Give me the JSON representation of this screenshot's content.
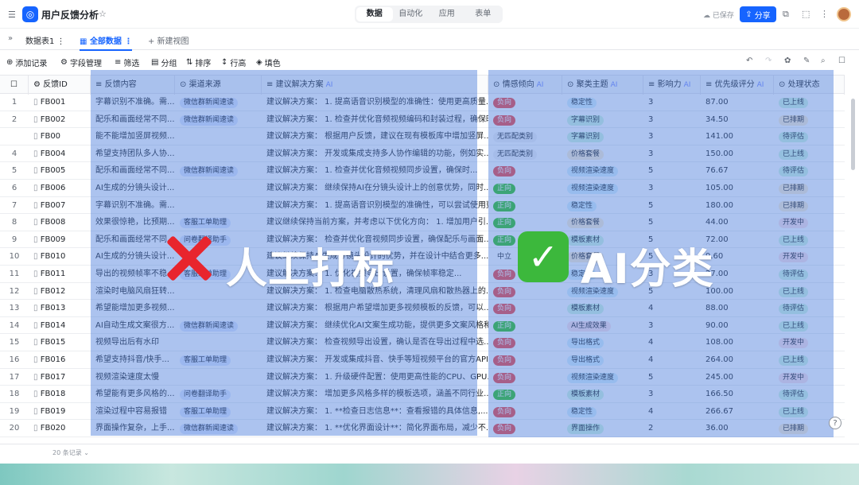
{
  "app": {
    "title": "用户反馈分析",
    "saved": "已保存",
    "share": "分享"
  },
  "nav_tabs": [
    "数据",
    "自动化",
    "应用",
    "表单"
  ],
  "sheet": {
    "name": "数据表1",
    "view": "全部数据",
    "new_view": "+ 新建视图"
  },
  "toolbar": {
    "add": "添加记录",
    "fields": "字段管理",
    "filter": "筛选",
    "group": "分组",
    "sort": "排序",
    "row_height": "行高",
    "fill": "填色"
  },
  "columns": {
    "id": "反馈ID",
    "content": "反馈内容",
    "source": "渠道来源",
    "solution": "建议解决方案",
    "sentiment": "情感倾向",
    "theme": "聚类主题",
    "impact": "影响力",
    "score": "优先级评分",
    "status": "处理状态",
    "ai": "AI"
  },
  "rows": [
    {
      "n": "1",
      "id": "FB001",
      "content": "字幕识别不准确。需...",
      "source": "微信群新闻速读",
      "solution": "建议解决方案： 1. 提高语音识别模型的准确性：使用更高质量...",
      "sent": "负向",
      "theme": "稳定性",
      "impact": "3",
      "score": "87.00",
      "status": "已上线"
    },
    {
      "n": "2",
      "id": "FB002",
      "content": "配乐和画面经常不同...",
      "source": "微信群新闻速读",
      "solution": "建议解决方案： 1. 检查并优化音频视频编码和封装过程，确保时...",
      "sent": "负向",
      "theme": "字幕识别",
      "impact": "3",
      "score": "34.50",
      "status": "已排期"
    },
    {
      "n": "",
      "id": "FB00",
      "content": "能不能增加竖屏视频...",
      "source": "",
      "solution": "建议解决方案： 根据用户反馈，建议在现有模板库中增加竖屏...",
      "sent": "无匹配类别",
      "theme": "字幕识别",
      "impact": "3",
      "score": "141.00",
      "status": "待评估"
    },
    {
      "n": "4",
      "id": "FB004",
      "content": "希望支持团队多人协...",
      "source": "",
      "solution": "建议解决方案： 开发或集成支持多人协作编辑的功能，例如实...",
      "sent": "无匹配类别",
      "theme": "价格套餐",
      "impact": "3",
      "score": "150.00",
      "status": "已上线"
    },
    {
      "n": "5",
      "id": "FB005",
      "content": "配乐和画面经常不同...",
      "source": "微信群新闻速读",
      "solution": "建议解决方案： 1. 检查并优化音频视频同步设置，确保时...",
      "sent": "负向",
      "theme": "视频渲染速度",
      "impact": "5",
      "score": "76.67",
      "status": "待评估"
    },
    {
      "n": "6",
      "id": "FB006",
      "content": "AI生成的分镜头设计...",
      "source": "",
      "solution": "建议解决方案： 继续保持AI在分镜头设计上的创意优势，同时...",
      "sent": "正向",
      "theme": "视频渲染速度",
      "impact": "3",
      "score": "105.00",
      "status": "已排期"
    },
    {
      "n": "7",
      "id": "FB007",
      "content": "字幕识别不准确。需...",
      "source": "",
      "solution": "建议解决方案： 1. 提高语音识别模型的准确性，可以尝试使用更高精度的模型...",
      "sent": "正向",
      "theme": "稳定性",
      "impact": "5",
      "score": "180.00",
      "status": "已排期"
    },
    {
      "n": "8",
      "id": "FB008",
      "content": "效果很惊艳，比预期...",
      "source": "客服工单助理",
      "solution": "建议继续保持当前方案，并考虑以下优化方向： 1. 增加用户引...",
      "sent": "正向",
      "theme": "价格套餐",
      "impact": "5",
      "score": "44.00",
      "status": "开发中"
    },
    {
      "n": "9",
      "id": "FB009",
      "content": "配乐和画面经常不同...",
      "source": "问卷翻译助手",
      "solution": "建议解决方案： 检查并优化音视频同步设置，确保配乐与画面...",
      "sent": "正向",
      "theme": "模板素材",
      "impact": "5",
      "score": "72.00",
      "status": "已上线"
    },
    {
      "n": "10",
      "id": "FB010",
      "content": "AI生成的分镜头设计...",
      "source": "",
      "solution": "建议继续保持AI生成分镜头设计的优势，并在设计中结合更多...",
      "sent": "中立",
      "theme": "价格套餐",
      "impact": "5",
      "score": "9.60",
      "status": "开发中"
    },
    {
      "n": "11",
      "id": "FB011",
      "content": "导出的视频帧率不稳...",
      "source": "客服工单助理",
      "solution": "建议解决方案： 1. 优化视频导出设置，确保帧率稳定...",
      "sent": "负向",
      "theme": "稳定性",
      "impact": "3",
      "score": "27.00",
      "status": "待评估"
    },
    {
      "n": "12",
      "id": "FB012",
      "content": "渲染时电脑风扇狂转...",
      "source": "",
      "solution": "建议解决方案： 1. 检查电脑散热系统，清理风扇和散热器上的...",
      "sent": "负向",
      "theme": "视频渲染速度",
      "impact": "5",
      "score": "100.00",
      "status": "已上线"
    },
    {
      "n": "13",
      "id": "FB013",
      "content": "希望能增加更多视频...",
      "source": "",
      "solution": "建议解决方案： 根据用户希望增加更多视频模板的反馈，可以...",
      "sent": "负向",
      "theme": "模板素材",
      "impact": "4",
      "score": "88.00",
      "status": "待评估"
    },
    {
      "n": "14",
      "id": "FB014",
      "content": "AI自动生成文案很方...",
      "source": "微信群新闻速读",
      "solution": "建议解决方案： 继续优化AI文案生成功能，提供更多文案风格和...",
      "sent": "正向",
      "theme": "AI生成效果",
      "impact": "3",
      "score": "90.00",
      "status": "已上线"
    },
    {
      "n": "15",
      "id": "FB015",
      "content": "视频导出后有水印",
      "source": "",
      "solution": "建议解决方案： 检查视频导出设置，确认是否在导出过程中选...",
      "sent": "负向",
      "theme": "导出格式",
      "impact": "4",
      "score": "108.00",
      "status": "开发中"
    },
    {
      "n": "16",
      "id": "FB016",
      "content": "希望支持抖音/快手...",
      "source": "客服工单助理",
      "solution": "建议解决方案： 开发或集成抖音、快手等短视频平台的官方API...",
      "sent": "负向",
      "theme": "导出格式",
      "impact": "4",
      "score": "264.00",
      "status": "已上线"
    },
    {
      "n": "17",
      "id": "FB017",
      "content": "视频渲染速度太慢",
      "source": "",
      "solution": "建议解决方案： 1. 升级硬件配置：使用更高性能的CPU、GPU...",
      "sent": "负向",
      "theme": "视频渲染速度",
      "impact": "5",
      "score": "245.00",
      "status": "开发中"
    },
    {
      "n": "18",
      "id": "FB018",
      "content": "希望能有更多风格的...",
      "source": "问卷翻译助手",
      "solution": "建议解决方案： 增加更多风格多样的模板选项，涵盖不同行业...",
      "sent": "正向",
      "theme": "模板素材",
      "impact": "3",
      "score": "166.50",
      "status": "待评估"
    },
    {
      "n": "19",
      "id": "FB019",
      "content": "渲染过程中容易报错",
      "source": "客服工单助理",
      "solution": "建议解决方案： 1. **检查日志信息**：查看报错的具体信息,...",
      "sent": "负向",
      "theme": "稳定性",
      "impact": "4",
      "score": "266.67",
      "status": "已上线"
    },
    {
      "n": "20",
      "id": "FB020",
      "content": "界面操作复杂，上手...",
      "source": "微信群新闻速读",
      "solution": "建议解决方案： 1. **优化界面设计**：简化界面布局，减少不...",
      "sent": "负向",
      "theme": "界面操作",
      "impact": "2",
      "score": "36.00",
      "status": "已排期"
    }
  ],
  "overlay": {
    "left": "人工打标",
    "right": "AI分类"
  },
  "footer": {
    "count": "20 条记录"
  },
  "colors": {
    "accent": "#1664ff",
    "negative": "#f54a45",
    "positive": "#34c724",
    "overlay": "#487adc"
  }
}
